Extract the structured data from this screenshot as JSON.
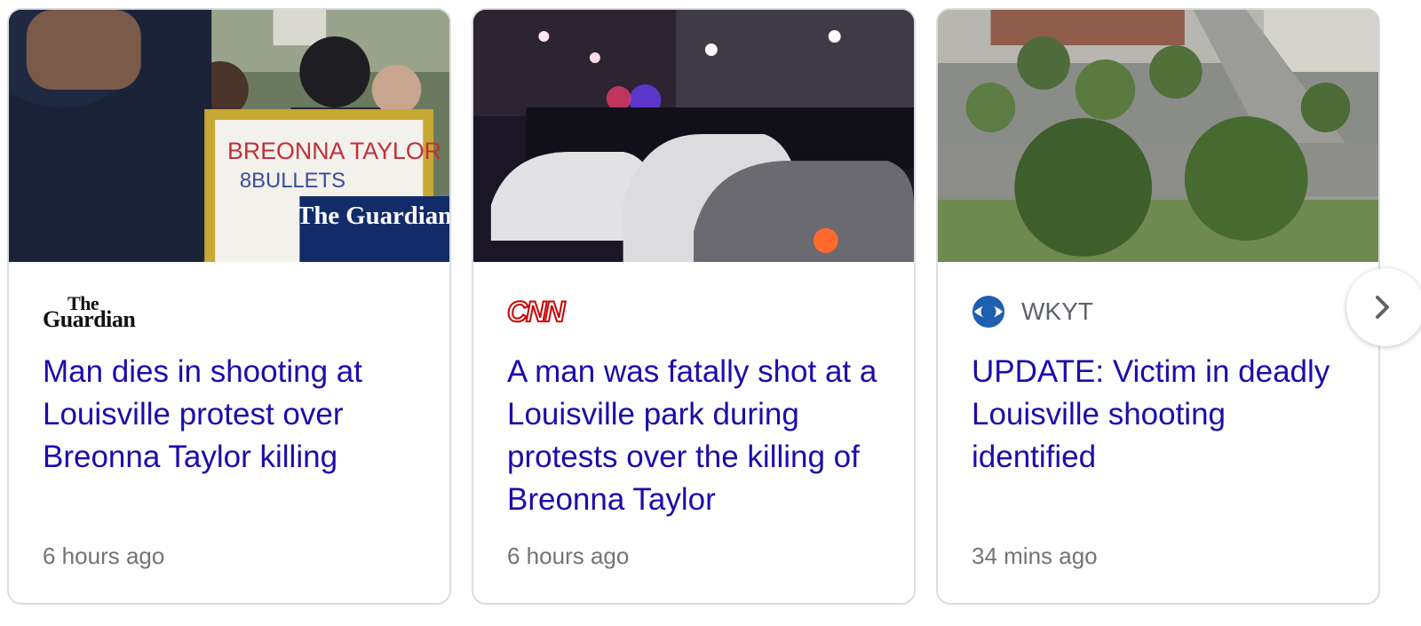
{
  "cards": [
    {
      "source": "The Guardian",
      "thumb_overlay": "The Guardian",
      "sign_line1": "BREONNA TAYLOR",
      "sign_line2": "8BULLETS",
      "headline": "Man dies in shooting at Louisville protest over Breonna Taylor killing",
      "time": "6 hours ago"
    },
    {
      "source": "CNN",
      "headline": "A man was fatally shot at a Louisville park during protests over the killing of Breonna Taylor",
      "time": "6 hours ago"
    },
    {
      "source": "WKYT",
      "source_icon": "cbs-eye-icon",
      "headline": "UPDATE: Victim in deadly Louisville shooting identified",
      "time": "34 mins ago"
    }
  ],
  "next_icon": "chevron-right-icon",
  "colors": {
    "headline": "#1a0dab",
    "meta": "#70757a",
    "cnn_red": "#cc0000",
    "cbs_blue": "#1565c0",
    "border": "#dadce0"
  }
}
